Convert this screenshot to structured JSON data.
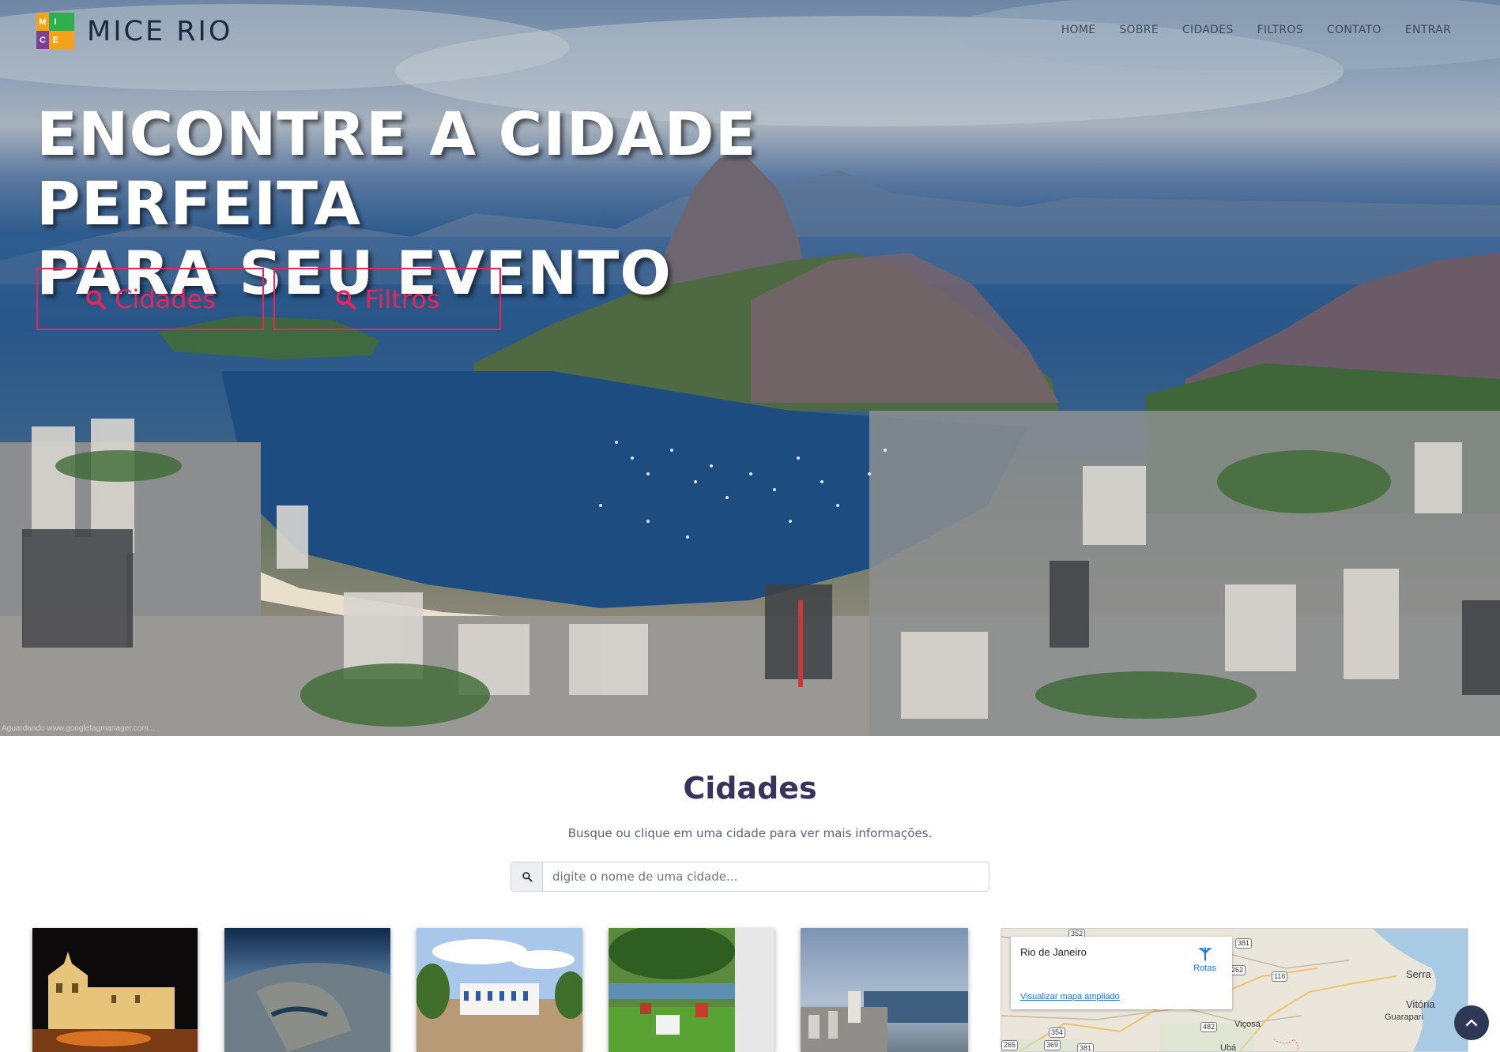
{
  "brand": {
    "name": "MICE RIO",
    "logo_letters": [
      "M",
      "I",
      "",
      "C",
      "E",
      ""
    ]
  },
  "nav": {
    "items": [
      {
        "label": "HOME"
      },
      {
        "label": "SOBRE"
      },
      {
        "label": "CIDADES"
      },
      {
        "label": "FILTROS"
      },
      {
        "label": "CONTATO"
      },
      {
        "label": "ENTRAR"
      }
    ]
  },
  "hero": {
    "title_line1": "ENCONTRE A CIDADE PERFEITA",
    "title_line2": "PARA SEU EVENTO",
    "btn_cidades": "Cidades",
    "btn_filtros": "Filtros",
    "caption": "Aguardando www.googletagmanager.com..."
  },
  "cidades": {
    "title": "Cidades",
    "subtitle": "Busque ou clique em uma cidade para ver mais informações.",
    "search_placeholder": "digite o nome de uma cidade..."
  },
  "map": {
    "place": "Rio de Janeiro",
    "directions": "Rotas",
    "enlarge": "Visualizar mapa ampliado",
    "labels": {
      "serra": "Serra",
      "vitoria": "Vitória",
      "guarapari": "Guarapari",
      "vicosa": "Viçosa",
      "uba": "Ubá"
    },
    "shields": {
      "s352": "352",
      "s381": "381",
      "s262": "262",
      "s116": "116",
      "s482": "482",
      "s354": "354",
      "s369": "369",
      "s381b": "381",
      "s265": "265"
    }
  },
  "colors": {
    "accent": "#e8245b",
    "title": "#36345c",
    "scroll_top": "#2e3755"
  },
  "icons": {
    "search": "search-icon",
    "directions": "directions-icon",
    "chevron_up": "chevron-up-icon"
  }
}
